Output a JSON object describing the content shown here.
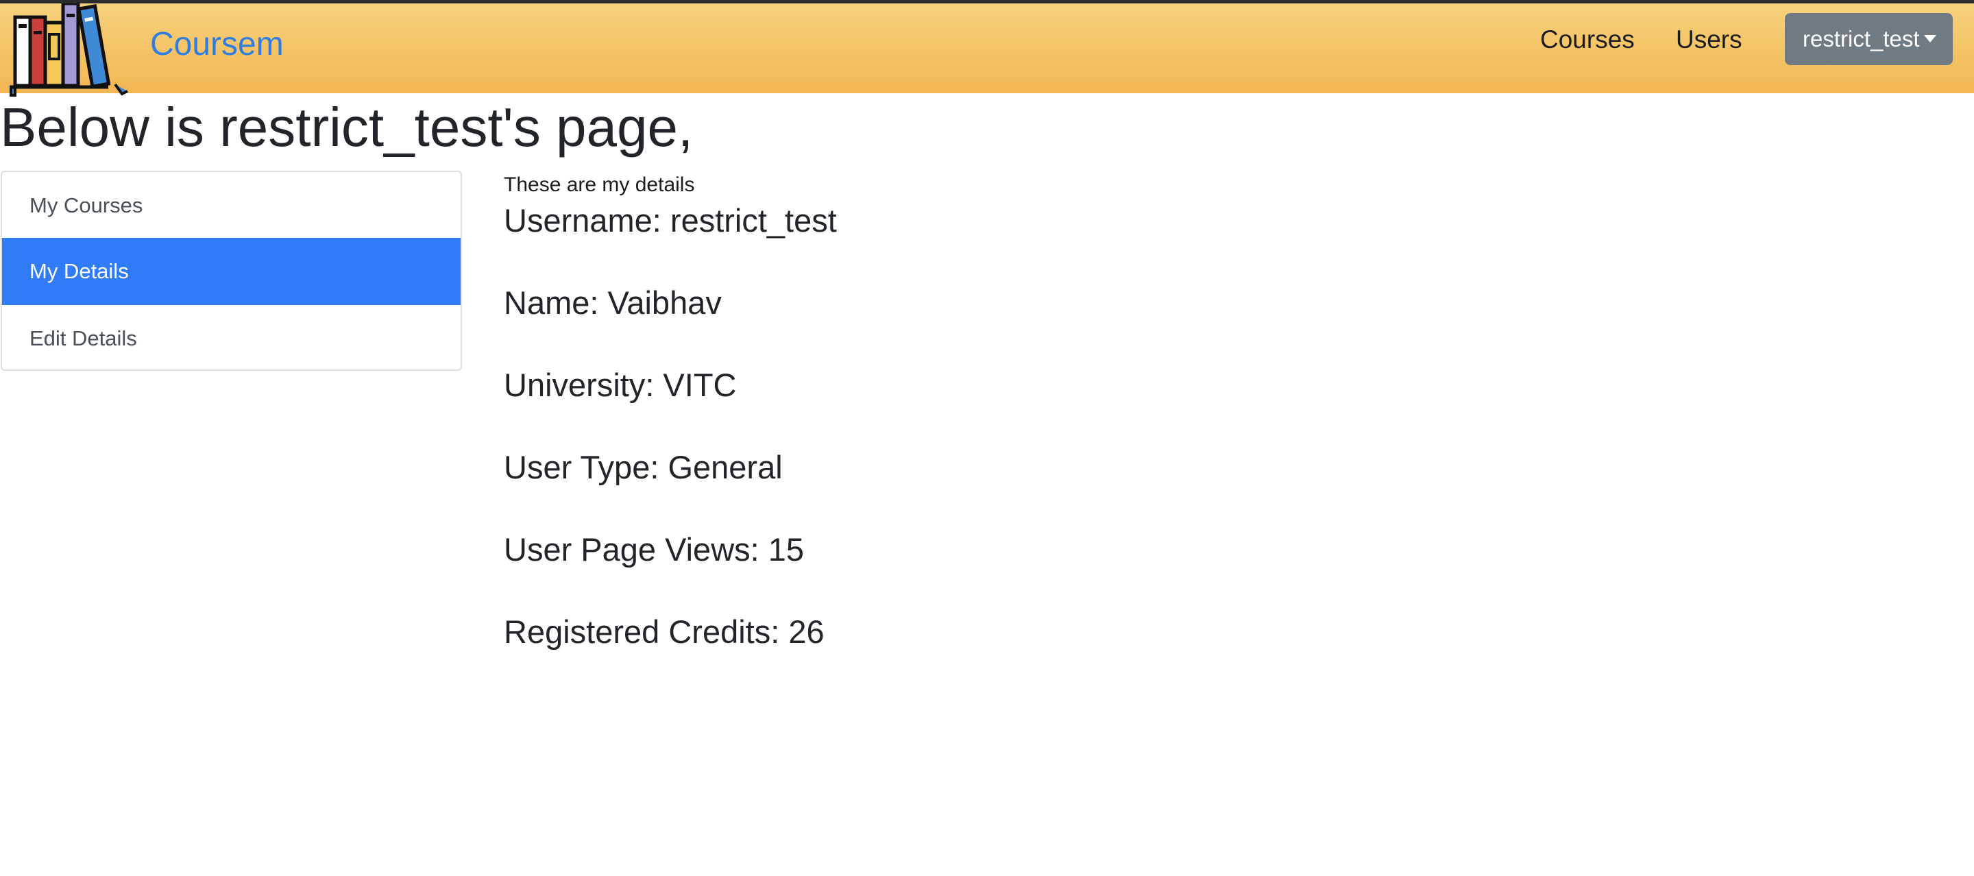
{
  "header": {
    "brand": "Coursem",
    "nav": {
      "courses": "Courses",
      "users": "Users"
    },
    "user_menu": "restrict_test",
    "logo_icon": "books-icon"
  },
  "page": {
    "title": "Below is restrict_test's page,"
  },
  "sidebar": {
    "items": [
      {
        "label": "My Courses",
        "active": false
      },
      {
        "label": "My Details",
        "active": true
      },
      {
        "label": "Edit Details",
        "active": false
      }
    ],
    "active_color": "#2f7cf6"
  },
  "details": {
    "intro": "These are my details",
    "username": "Username: restrict_test",
    "name": "Name: Vaibhav",
    "university": "University: VITC",
    "user_type": "User Type: General",
    "page_views": "User Page Views: 15",
    "credits": "Registered Credits: 26"
  },
  "colors": {
    "navbar_top": "#f7d27c",
    "navbar_bottom": "#f2b652",
    "brand": "#2f7de1",
    "user_button": "#707a82"
  }
}
